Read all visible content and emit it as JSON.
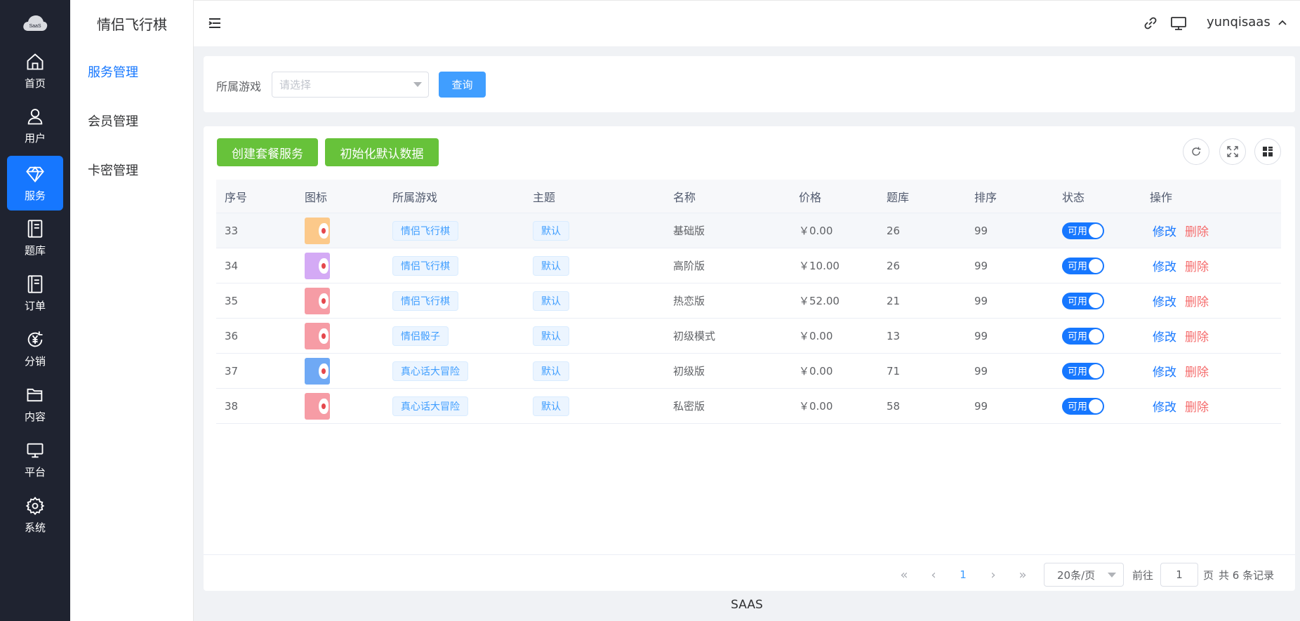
{
  "logo": {
    "text": "SaaS"
  },
  "rail": [
    {
      "label": "首页",
      "icon": "home-icon"
    },
    {
      "label": "用户",
      "icon": "user-icon"
    },
    {
      "label": "服务",
      "icon": "diamond-icon"
    },
    {
      "label": "题库",
      "icon": "book-icon"
    },
    {
      "label": "订单",
      "icon": "order-icon"
    },
    {
      "label": "分销",
      "icon": "yen-icon"
    },
    {
      "label": "内容",
      "icon": "folder-icon"
    },
    {
      "label": "平台",
      "icon": "monitor-icon"
    },
    {
      "label": "系统",
      "icon": "gear-icon"
    }
  ],
  "subnav": {
    "title": "情侣飞行棋",
    "items": [
      "服务管理",
      "会员管理",
      "卡密管理"
    ]
  },
  "header": {
    "username": "yunqisaas"
  },
  "search": {
    "label": "所属游戏",
    "placeholder": "请选择",
    "query_label": "查询"
  },
  "toolbar": {
    "create_label": "创建套餐服务",
    "init_label": "初始化默认数据"
  },
  "table": {
    "columns": [
      "序号",
      "图标",
      "所属游戏",
      "主题",
      "名称",
      "价格",
      "题库",
      "排序",
      "状态",
      "操作"
    ],
    "rows": [
      {
        "id": "33",
        "thumb_color": "#fcc98a",
        "game": "情侣飞行棋",
        "theme": "默认",
        "name": "基础版",
        "price": "￥0.00",
        "bank": "26",
        "sort": "99",
        "status": "可用"
      },
      {
        "id": "34",
        "thumb_color": "#d4aaf5",
        "game": "情侣飞行棋",
        "theme": "默认",
        "name": "高阶版",
        "price": "￥10.00",
        "bank": "26",
        "sort": "99",
        "status": "可用"
      },
      {
        "id": "35",
        "thumb_color": "#f69ca5",
        "game": "情侣飞行棋",
        "theme": "默认",
        "name": "热恋版",
        "price": "￥52.00",
        "bank": "21",
        "sort": "99",
        "status": "可用"
      },
      {
        "id": "36",
        "thumb_color": "#f69ca5",
        "game": "情侣骰子",
        "theme": "默认",
        "name": "初级模式",
        "price": "￥0.00",
        "bank": "13",
        "sort": "99",
        "status": "可用"
      },
      {
        "id": "37",
        "thumb_color": "#6fa9f5",
        "game": "真心话大冒险",
        "theme": "默认",
        "name": "初级版",
        "price": "￥0.00",
        "bank": "71",
        "sort": "99",
        "status": "可用"
      },
      {
        "id": "38",
        "thumb_color": "#f69ca5",
        "game": "真心话大冒险",
        "theme": "默认",
        "name": "私密版",
        "price": "￥0.00",
        "bank": "58",
        "sort": "99",
        "status": "可用"
      }
    ],
    "edit_label": "修改",
    "delete_label": "删除"
  },
  "pager": {
    "current": "1",
    "page_size": "20条/页",
    "goto_prefix": "前往",
    "goto_value": "1",
    "goto_suffix": "页",
    "total": "共 6 条记录"
  },
  "footer": {
    "text": "SAAS"
  }
}
